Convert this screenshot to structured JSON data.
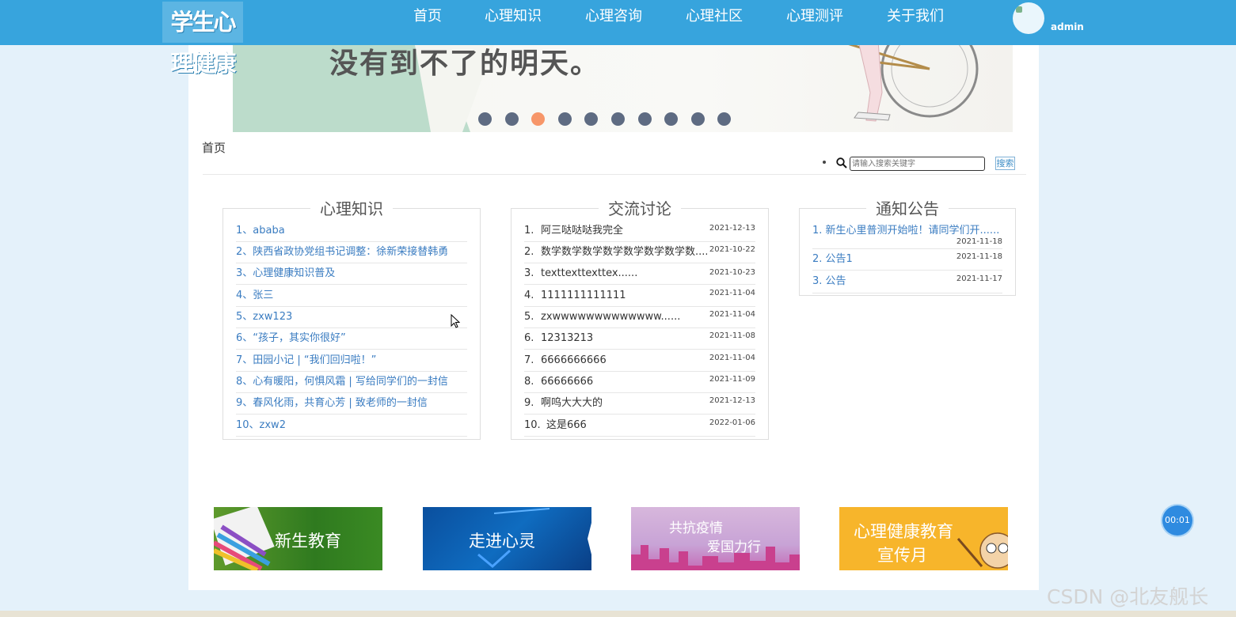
{
  "header": {
    "logo_text": "学生心理健康",
    "nav": [
      "首页",
      "心理知识",
      "心理咨询",
      "心理社区",
      "心理测评",
      "关于我们"
    ],
    "username": "admin"
  },
  "banner": {
    "slogan": "没有到不了的明天。",
    "slide_count": 10,
    "active_slide": 3
  },
  "breadcrumb": "首页",
  "search": {
    "placeholder": "请输入搜索关键字",
    "button_label": "搜索"
  },
  "knowledge": {
    "title": "心理知识",
    "items": [
      "1、ababa",
      "2、陕西省政协党组书记调整：徐新荣接替韩勇",
      "3、心理健康知识普及",
      "4、张三",
      "5、zxw123",
      "6、“孩子，其实你很好”",
      "7、田园小记 | “我们回归啦！”",
      "8、心有暖阳，何惧风霜 | 写给同学们的一封信",
      "9、春风化雨，共育心芳 | 致老师的一封信",
      "10、zxw2"
    ]
  },
  "discussion": {
    "title": "交流讨论",
    "items": [
      {
        "num": "1.",
        "text": "阿三哒哒哒我完全",
        "date": "2021-12-13"
      },
      {
        "num": "2.",
        "text": "数学数学数学数学数学数学数学数......",
        "date": "2021-10-22"
      },
      {
        "num": "3.",
        "text": "texttexttexttex......",
        "date": "2021-10-23"
      },
      {
        "num": "4.",
        "text": "1111111111111",
        "date": "2021-11-04"
      },
      {
        "num": "5.",
        "text": "zxwwwwwwwwwwwww......",
        "date": "2021-11-04"
      },
      {
        "num": "6.",
        "text": "12313213",
        "date": "2021-11-08"
      },
      {
        "num": "7.",
        "text": "6666666666",
        "date": "2021-11-04"
      },
      {
        "num": "8.",
        "text": "66666666",
        "date": "2021-11-09"
      },
      {
        "num": "9.",
        "text": "啊呜大大大的",
        "date": "2021-12-13"
      },
      {
        "num": "10.",
        "text": "这是666",
        "date": "2022-01-06"
      }
    ]
  },
  "notices": {
    "title": "通知公告",
    "items": [
      {
        "text": "1. 新生心里普测开始啦！请同学们开......",
        "date": "2021-11-18"
      },
      {
        "text": "2. 公告1",
        "date": "2021-11-18"
      },
      {
        "text": "3. 公告",
        "date": "2021-11-17"
      }
    ]
  },
  "tiles": [
    {
      "label": "新生教育"
    },
    {
      "label": "走进心灵"
    },
    {
      "label_line1": "共抗疫情",
      "label_line2": "爱国力行"
    },
    {
      "label_line1": "心理健康教育",
      "label_line2": "宣传月"
    }
  ],
  "timer": "00:01",
  "watermark": "CSDN @北友舰长",
  "colors": {
    "nav_bg": "#37a4dd",
    "page_bg": "#e4f1fa",
    "link": "#3a7cc1",
    "active_dot": "#f79669"
  }
}
